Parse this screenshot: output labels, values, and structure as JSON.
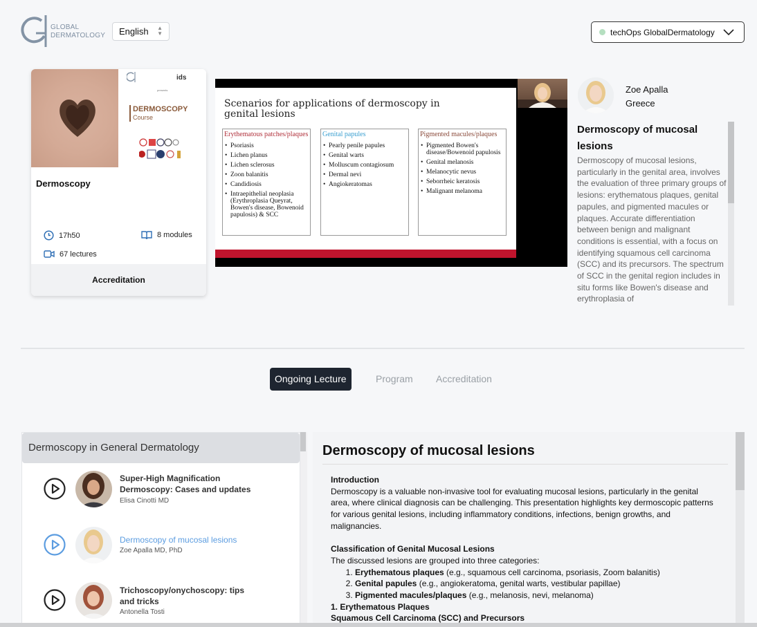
{
  "header": {
    "logo_line1": "GLOBAL",
    "logo_line2": "DERMATOLOGY",
    "language": "English",
    "user": "techOps GlobalDermatology"
  },
  "course_card": {
    "poster_title": "DERMOSCOPY",
    "poster_subtitle": "Course",
    "poster_presents": "presents",
    "poster_ids": "ids",
    "title": "Dermoscopy",
    "duration": "17h50",
    "modules": "8 modules",
    "lectures": "67 lectures",
    "footer": "Accreditation"
  },
  "slide": {
    "title_line1": "Scenarios for applications of dermoscopy in",
    "title_line2": "genital lesions",
    "columns": [
      {
        "heading": "Erythematous patches/plaques",
        "color": "#b0303a",
        "items": [
          "Psoriasis",
          "Lichen planus",
          "Lichen sclerosus",
          "Zoon balanitis",
          "Candidiosis",
          "Intraepithelial neoplasia (Erythroplasia Queyrat, Bowen's disease, Bowenoid papulosis) & SCC"
        ]
      },
      {
        "heading": "Genital papules",
        "color": "#3a9fd0",
        "items": [
          "Pearly penile papules",
          "Genital warts",
          "Molluscum contagiosum",
          "Dermal nevi",
          "Angiokeratomas"
        ]
      },
      {
        "heading": "Pigmented macules/plaques",
        "color": "#8a4a3a",
        "items": [
          "Pigmented Bowen's disease/Bowenoid papulosis",
          "Genital melanosis",
          "Melanocytic nevus",
          "Seborrheic keratosis",
          "Malignant melanoma"
        ]
      }
    ]
  },
  "speaker": {
    "name": "Zoe Apalla",
    "country": "Greece",
    "lecture_title": "Dermoscopy of mucosal lesions",
    "description": "Dermoscopy of mucosal lesions, particularly in the genital area, involves the evaluation of three primary groups of lesions: erythematous plaques, genital papules, and pigmented macules or plaques. Accurate differentiation between benign and malignant conditions is essential, with a focus on identifying squamous cell carcinoma (SCC) and its precursors. The spectrum of SCC in the genital region includes in situ forms like Bowen's disease and erythroplasia of"
  },
  "tabs": [
    "Ongoing Lecture",
    "Program",
    "Accreditation"
  ],
  "module": {
    "title": "Dermoscopy in General Dermatology",
    "lectures": [
      {
        "title": "Super-High Magnification Dermoscopy: Cases and updates",
        "speaker": "Elisa Cinotti MD",
        "current": false
      },
      {
        "title": "Dermoscopy of mucosal lesions",
        "speaker": "Zoe Apalla MD, PhD",
        "current": true
      },
      {
        "title": "Trichoscopy/onychoscopy: tips and tricks",
        "speaker": "Antonella Tosti",
        "current": false
      }
    ]
  },
  "content": {
    "title": "Dermoscopy of mucosal lesions",
    "intro_heading": "Introduction",
    "intro_text": "Dermoscopy is a valuable non-invasive tool for evaluating mucosal lesions, particularly in the genital area, where clinical diagnosis can be challenging. This presentation highlights key dermoscopic patterns for various genital lesions, including inflammatory conditions, infections, benign growths, and malignancies.",
    "class_heading": "Classification of Genital Mucosal Lesions",
    "class_text": "The discussed lesions are grouped into three categories:",
    "class_items": [
      {
        "bold": "Erythematous plaques",
        "rest": " (e.g., squamous cell carcinoma, psoriasis, Zoom balanitis)"
      },
      {
        "bold": "Genital papules",
        "rest": " (e.g., angiokeratoma, genital warts, vestibular papillae)"
      },
      {
        "bold": "Pigmented macules/plaques",
        "rest": " (e.g., melanosis, nevi, melanoma)"
      }
    ],
    "section1": "1. Erythematous Plaques",
    "section1_sub": "Squamous Cell Carcinoma (SCC) and Precursors"
  }
}
